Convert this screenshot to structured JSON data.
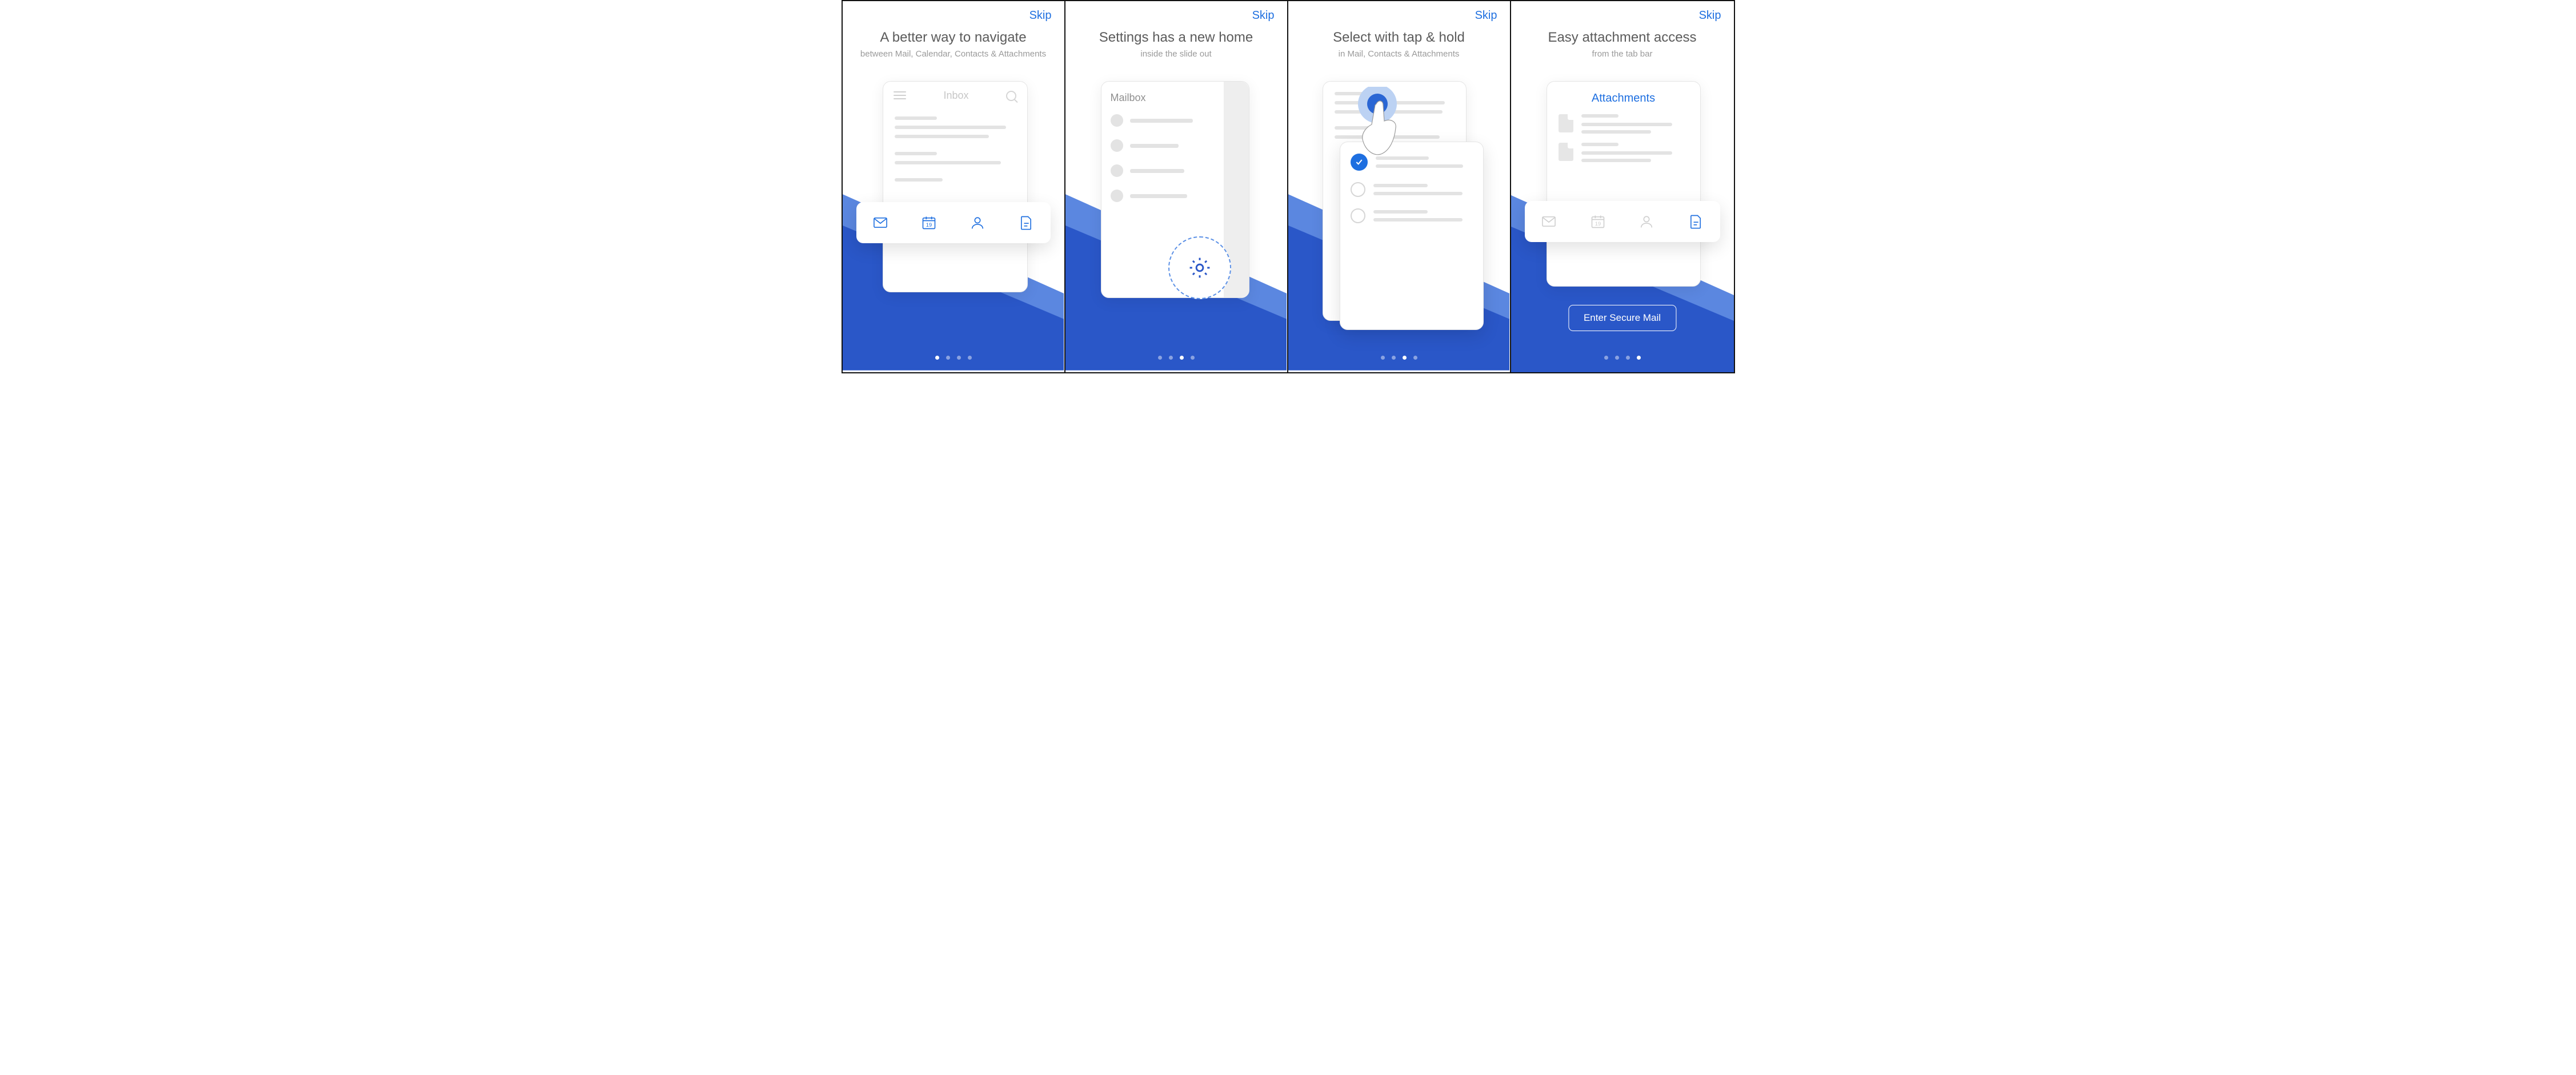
{
  "common": {
    "skip_label": "Skip"
  },
  "screens": [
    {
      "title": "A better way to navigate",
      "subtitle": "between Mail, Calendar, Contacts & Attachments",
      "inbox_label": "Inbox",
      "calendar_day": "19",
      "active_dot": 0
    },
    {
      "title": "Settings has a new home",
      "subtitle": "inside the slide out",
      "mailbox_label": "Mailbox",
      "active_dot": 2
    },
    {
      "title": "Select with tap & hold",
      "subtitle": "in Mail, Contacts & Attachments",
      "active_dot": 2
    },
    {
      "title": "Easy attachment access",
      "subtitle": "from the tab bar",
      "attachments_label": "Attachments",
      "calendar_day": "19",
      "enter_label": "Enter Secure Mail",
      "active_dot": 3
    }
  ]
}
